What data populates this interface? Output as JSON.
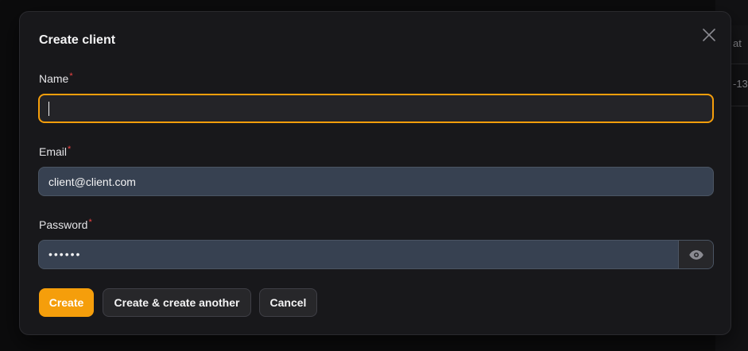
{
  "background": {
    "column_header_fragment": "at",
    "cell_fragment": "-13"
  },
  "modal": {
    "title": "Create client",
    "close_icon": "x-icon",
    "fields": {
      "name": {
        "label": "Name",
        "required_mark": "*",
        "value": ""
      },
      "email": {
        "label": "Email",
        "required_mark": "*",
        "value": "client@client.com"
      },
      "password": {
        "label": "Password",
        "required_mark": "*",
        "value": "••••••",
        "toggle_icon": "eye-icon"
      }
    },
    "actions": {
      "create": "Create",
      "create_another": "Create & create another",
      "cancel": "Cancel"
    }
  },
  "colors": {
    "accent": "#f59e0b",
    "required": "#ef4444",
    "modal_bg": "#18181b",
    "input_bg": "#374151"
  }
}
